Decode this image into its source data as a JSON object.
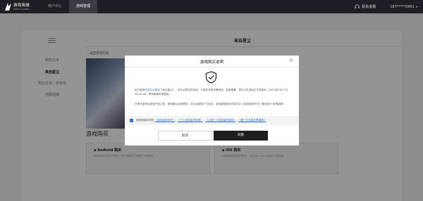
{
  "topbar": {
    "logo_text": "游戏商城",
    "logo_sub": "JUNHAI GAMES",
    "nav": [
      {
        "label": "用户中心",
        "active": false
      },
      {
        "label": "游戏管理",
        "active": true
      }
    ],
    "service_label": "联系客服",
    "phone": "187*****0861"
  },
  "sidebar": {
    "items": [
      {
        "label": "明日方舟",
        "active": false
      },
      {
        "label": "来自星尘",
        "active": true
      },
      {
        "label": "明日方舟：终末地",
        "active": false
      },
      {
        "label": "泡姆泡姆",
        "active": false
      }
    ]
  },
  "main": {
    "title": "来自星尘",
    "back_label": "返回游戏列表",
    "purchase_title": "游戏购买",
    "cards": [
      {
        "title": "Android 购买",
        "desc": "将游戏添加到用户账号，在本设备的应用商店下载使用"
      },
      {
        "title": "iOS 购买",
        "desc": "将游戏添加到用户账号，前往App Store商店中下载使用"
      }
    ]
  },
  "dialog": {
    "title": "游戏购买说明",
    "paragraph1_a": "您已选择",
    "paragraph1_platform": "安卓平台",
    "paragraph1_b": "购买《来自星尘》，本平台购买的游戏，只能在安卓设备使用。如有需要，您可以在游戏正式发售前（2024年2月27日00:00:00）联系客服申请退款。",
    "paragraph2": "在您决定购买游戏产品之前，请您确认自身需求，并认真阅读下方协议：游戏退款相关内容详见《游戏使用许可》第四部分“拒两退款”。",
    "agree_prefix": "请您阅读并同意",
    "agree_links": [
      "《游戏使用许可》",
      "《个人信息保护政策》",
      "《儿童个人信息保护政策》",
      "《第三方信息共享清单》"
    ],
    "cancel_label": "取消",
    "confirm_label": "同意"
  },
  "colors": {
    "accent": "#2e6bbf",
    "dark": "#1f1f22",
    "topbar": "#1d1f23"
  },
  "icons": {
    "shield": "shield-check-icon",
    "close": "close-icon",
    "service": "headset-icon",
    "back": "chevron-left-icon"
  }
}
